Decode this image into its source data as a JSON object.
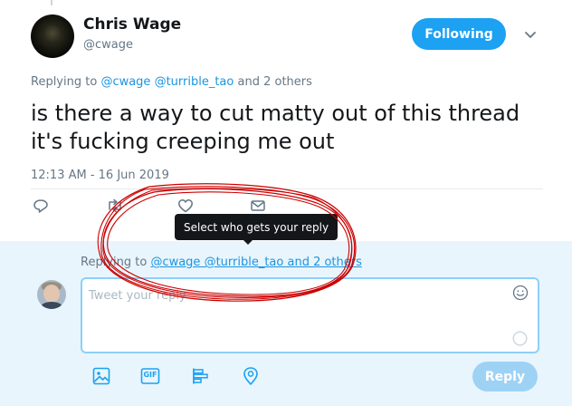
{
  "tweet": {
    "author_name": "Chris Wage",
    "author_handle": "@cwage",
    "follow_label": "Following",
    "replying_prefix": "Replying to",
    "replying_handles": "@cwage @turrible_tao",
    "replying_suffix": "and 2 others",
    "text_line1": "is there a way to cut matty out of this thread",
    "text_line2": "it's fucking creeping me out",
    "timestamp": "12:13 AM - 16 Jun 2019"
  },
  "actions": {
    "reply_icon": "reply-icon",
    "retweet_icon": "retweet-icon",
    "like_icon": "heart-icon",
    "dm_icon": "envelope-icon"
  },
  "tooltip": {
    "text": "Select who gets your reply"
  },
  "composer": {
    "replying_prefix": "Replying to",
    "replying_link": "@cwage @turrible_tao and 2 others",
    "placeholder": "Tweet your reply",
    "reply_label": "Reply",
    "icons": [
      "image-icon",
      "gif-icon",
      "poll-icon",
      "location-icon"
    ],
    "gif_text": "GIF"
  },
  "colors": {
    "accent": "#1da1f2",
    "annotation": "#cc0000",
    "composer_bg": "#e8f5fd",
    "muted_text": "#657786"
  }
}
